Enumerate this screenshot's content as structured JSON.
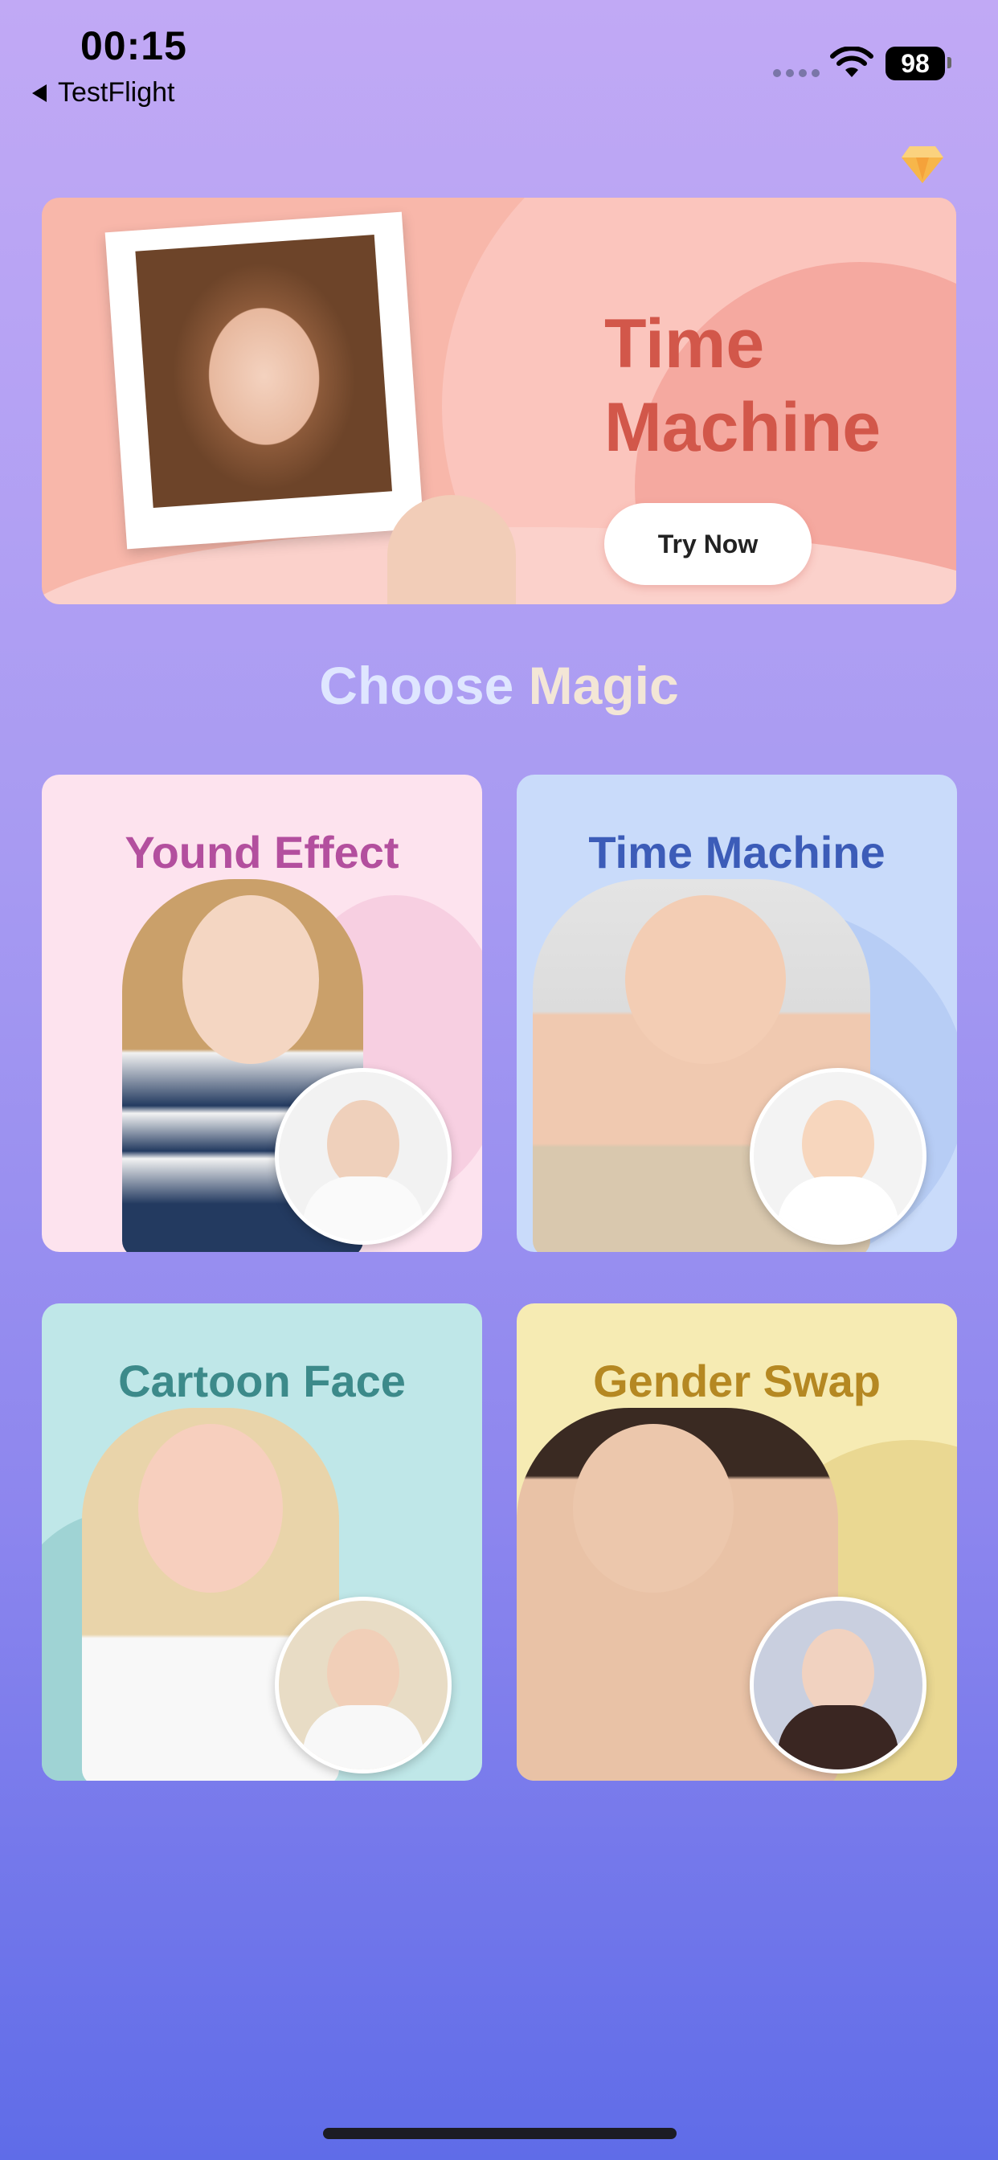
{
  "status_bar": {
    "time": "00:15",
    "back_label": "TestFlight",
    "battery": "98"
  },
  "icons": {
    "premium": "diamond-icon",
    "wifi": "wifi-icon",
    "back": "back-arrow-icon"
  },
  "hero": {
    "title_line1": "Time",
    "title_line2": "Machine",
    "button_label": "Try Now"
  },
  "section_title": {
    "part1": "Choose",
    "part2": "Magic"
  },
  "cards": [
    {
      "title": "Yound Effect"
    },
    {
      "title": "Time Machine"
    },
    {
      "title": "Cartoon Face"
    },
    {
      "title": "Gender Swap"
    }
  ],
  "colors": {
    "hero_bg": "#f8b7aa",
    "hero_title": "#d2574a",
    "young_title": "#b34f9e",
    "time_title": "#3c5cb8",
    "cartoon_title": "#3c8a8a",
    "gender_title": "#b58822"
  }
}
